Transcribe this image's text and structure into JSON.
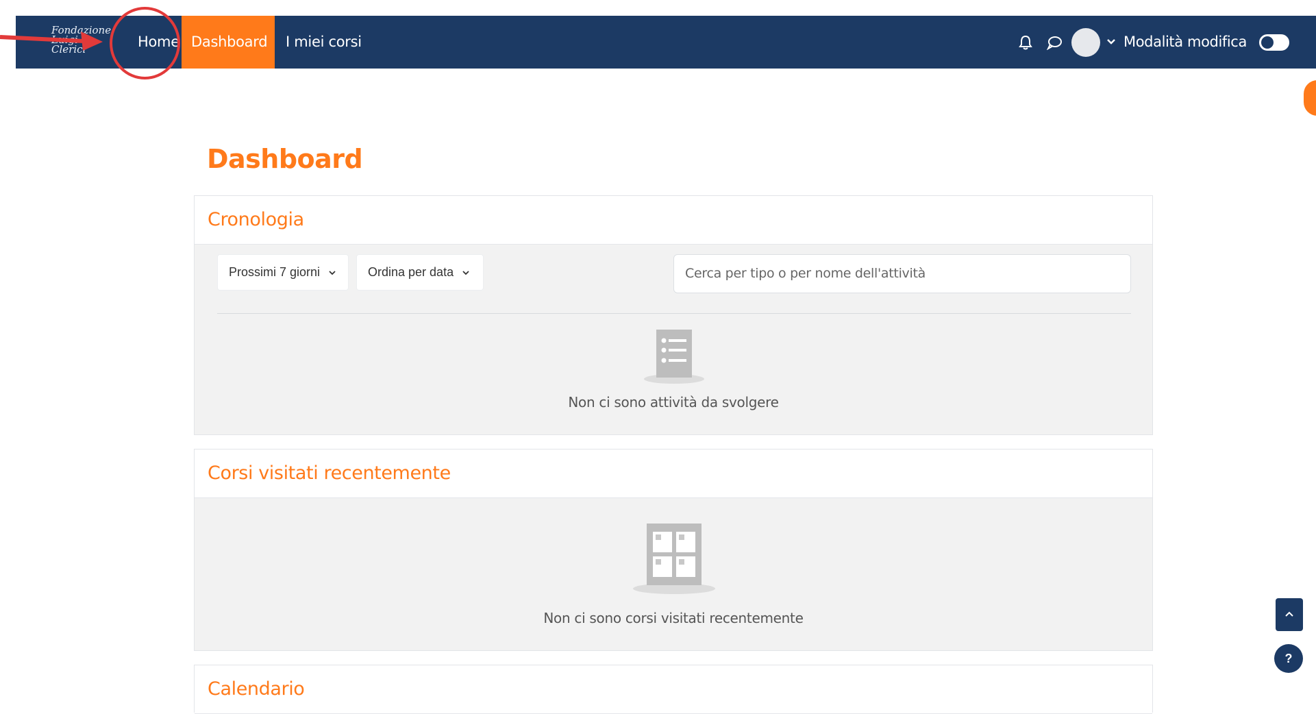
{
  "logo": {
    "lines": [
      "Fondazione",
      "Luigi",
      "Clerici"
    ]
  },
  "nav": {
    "home": "Home",
    "dashboard": "Dashboard",
    "courses": "I miei corsi"
  },
  "user_bar": {
    "edit_mode": "Modalità modifica"
  },
  "page": {
    "title": "Dashboard"
  },
  "timeline": {
    "title": "Cronologia",
    "range_filter": "Prossimi 7 giorni",
    "sort_filter": "Ordina per data",
    "search_placeholder": "Cerca per tipo o per nome dell'attività",
    "empty": "Non ci sono attività da svolgere"
  },
  "recent_courses": {
    "title": "Corsi visitati recentemente",
    "empty": "Non ci sono corsi visitati recentemente"
  },
  "calendar": {
    "title": "Calendario"
  },
  "help": {
    "label": "?"
  },
  "colors": {
    "navbar": "#1c3a64",
    "accent": "#ff7a1a",
    "annotation": "#e23a3a"
  }
}
